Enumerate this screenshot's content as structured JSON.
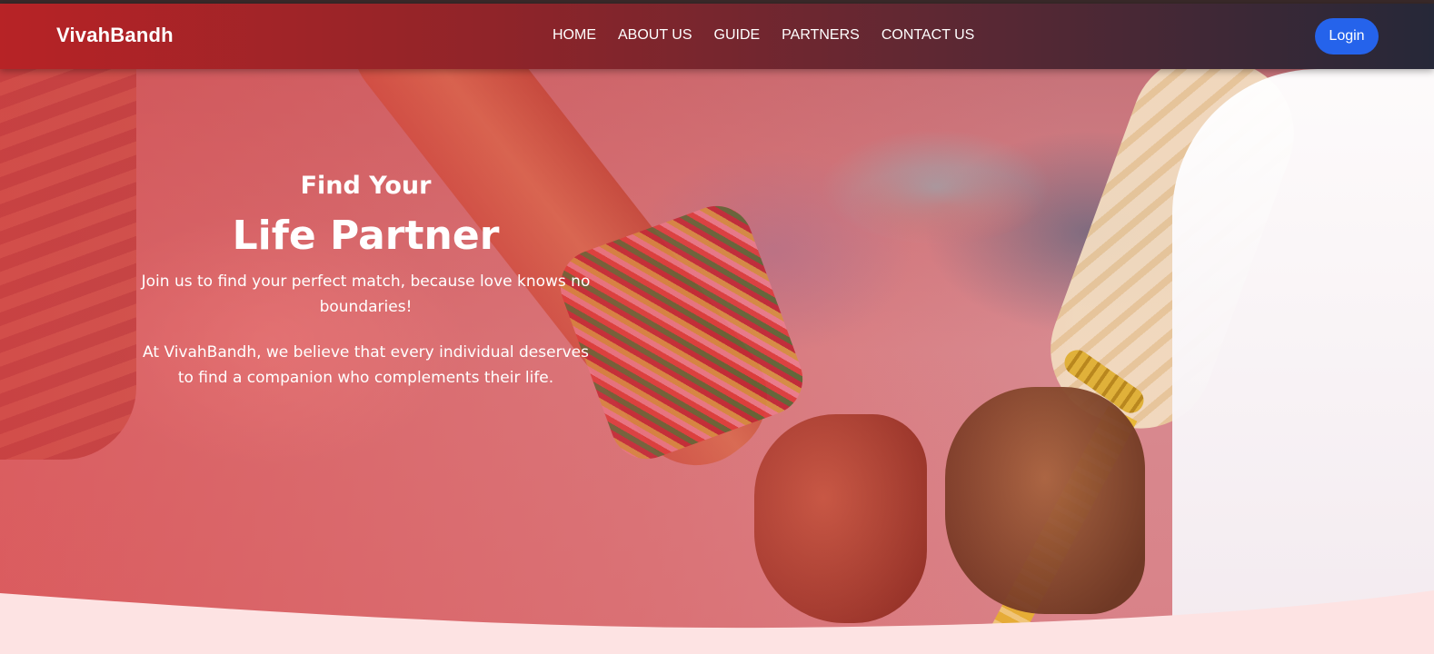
{
  "brand": {
    "name": "VivahBandh"
  },
  "nav": {
    "items": [
      {
        "label": "HOME"
      },
      {
        "label": "ABOUT US"
      },
      {
        "label": "GUIDE"
      },
      {
        "label": "PARTNERS"
      },
      {
        "label": "CONTACT US"
      }
    ],
    "login_label": "Login"
  },
  "hero": {
    "kicker": "Find Your",
    "title": "Life Partner",
    "text1": "Join us to find your perfect match, because love knows no boundaries!",
    "text2": "At VivahBandh, we believe that every individual deserves to find a companion who complements their life."
  },
  "colors": {
    "navbar_start": "#b72326",
    "navbar_end": "#262838",
    "login_button": "#2563eb",
    "page_background": "#fde3e3"
  }
}
